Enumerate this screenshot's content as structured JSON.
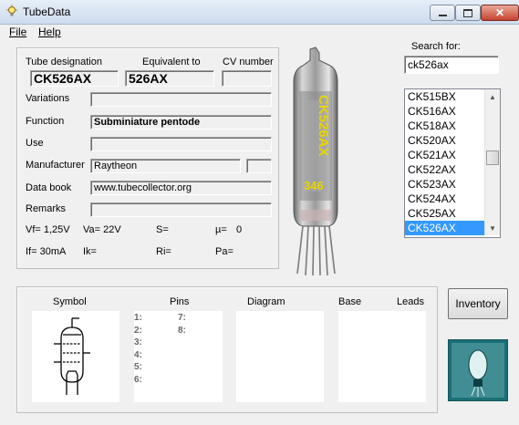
{
  "window": {
    "title": "TubeData",
    "minimize_icon": "minimize-icon",
    "maximize_icon": "maximize-icon",
    "close_icon": "close-icon"
  },
  "menu": {
    "file": "File",
    "help": "Help"
  },
  "search": {
    "label": "Search for:",
    "value": "ck526ax"
  },
  "tube_list": {
    "items": [
      "CK515BX",
      "CK516AX",
      "CK518AX",
      "CK520AX",
      "CK521AX",
      "CK522AX",
      "CK523AX",
      "CK524AX",
      "CK525AX",
      "CK526AX"
    ],
    "selected": "CK526AX"
  },
  "details": {
    "tube_designation_label": "Tube designation",
    "tube_designation": "CK526AX",
    "equivalent_label": "Equivalent to",
    "equivalent": "526AX",
    "cv_label": "CV number",
    "cv": "",
    "variations_label": "Variations",
    "variations": "",
    "function_label": "Function",
    "function": "Subminiature pentode",
    "use_label": "Use",
    "use": "",
    "manufacturer_label": "Manufacturer",
    "manufacturer": "Raytheon",
    "databook_label": "Data book",
    "databook": "www.tubecollector.org",
    "remarks_label": "Remarks",
    "remarks": ""
  },
  "params": {
    "vf": "Vf= 1,25V",
    "va": "Va= 22V",
    "s": "S=",
    "mu": "µ=",
    "mu_value": "0",
    "if": "If= 30mA",
    "ik": "Ik=",
    "ri": "Ri=",
    "pa": "Pa="
  },
  "image_text": {
    "line1": "CK526AX",
    "code": "346"
  },
  "bottom": {
    "symbol_label": "Symbol",
    "pins_label": "Pins",
    "diagram_label": "Diagram",
    "base_label": "Base",
    "leads_label": "Leads",
    "pins_left": [
      "1:",
      "2:",
      "3:",
      "4:",
      "5:",
      "6:"
    ],
    "pins_right": [
      "7:",
      "8:"
    ]
  },
  "inventory_button": "Inventory",
  "colors": {
    "selection": "#3399ff",
    "window_bg": "#f0f0f0",
    "tube_text": "#e8d400"
  }
}
